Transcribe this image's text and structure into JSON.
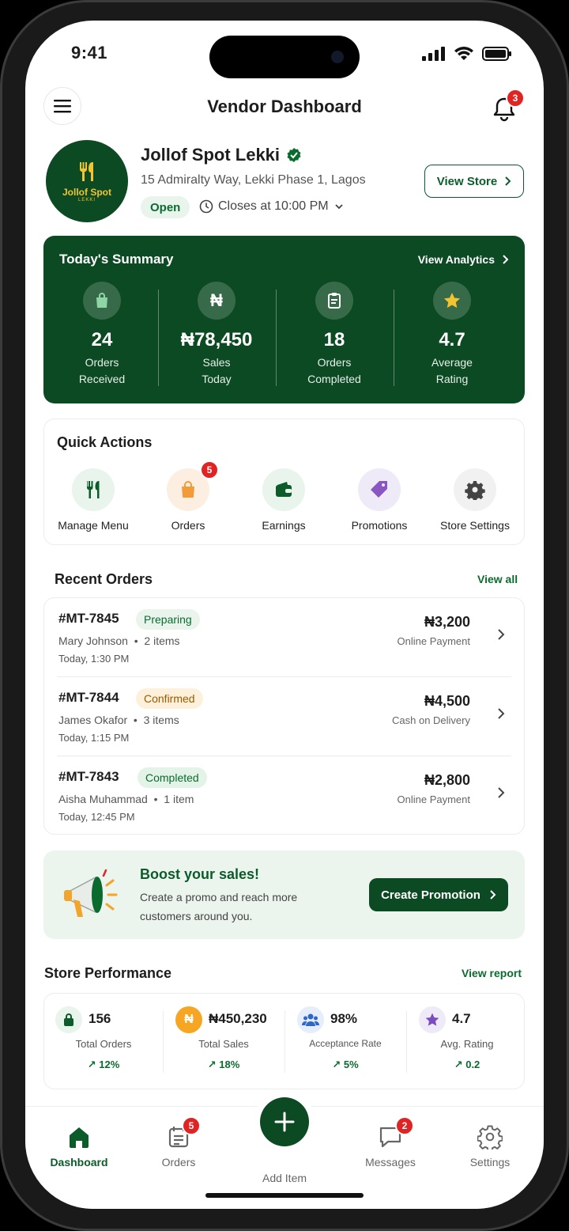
{
  "status_bar": {
    "time": "9:41"
  },
  "header": {
    "title": "Vendor Dashboard",
    "notification_count": "3"
  },
  "store": {
    "logo_name": "Jollof Spot",
    "logo_sub": "LEKKI",
    "name": "Jollof Spot Lekki",
    "address": "15 Admiralty Way, Lekki Phase 1, Lagos",
    "status": "Open",
    "closes": "Closes at 10:00 PM",
    "view_store_label": "View Store"
  },
  "summary": {
    "title": "Today's Summary",
    "link": "View Analytics",
    "stats": [
      {
        "value": "24",
        "label1": "Orders",
        "label2": "Received",
        "icon": "shopping-bag-icon"
      },
      {
        "value": "₦78,450",
        "label1": "Sales",
        "label2": "Today",
        "icon": "naira-icon"
      },
      {
        "value": "18",
        "label1": "Orders",
        "label2": "Completed",
        "icon": "clipboard-icon"
      },
      {
        "value": "4.7",
        "label1": "Average",
        "label2": "Rating",
        "icon": "star-icon"
      }
    ]
  },
  "quick_actions": {
    "title": "Quick Actions",
    "items": [
      {
        "label": "Manage Menu",
        "icon": "fork-knife-icon"
      },
      {
        "label": "Orders",
        "icon": "shopping-bag-icon",
        "badge": "5"
      },
      {
        "label": "Earnings",
        "icon": "wallet-icon"
      },
      {
        "label": "Promotions",
        "icon": "tag-icon"
      },
      {
        "label": "Store Settings",
        "icon": "gear-icon"
      }
    ]
  },
  "recent_orders": {
    "title": "Recent Orders",
    "view_all": "View all",
    "orders": [
      {
        "id": "#MT-7845",
        "status": "Preparing",
        "customer": "Mary Johnson",
        "items": "2 items",
        "time": "Today, 1:30 PM",
        "amount": "₦3,200",
        "payment": "Online Payment"
      },
      {
        "id": "#MT-7844",
        "status": "Confirmed",
        "customer": "James Okafor",
        "items": "3 items",
        "time": "Today, 1:15 PM",
        "amount": "₦4,500",
        "payment": "Cash on Delivery"
      },
      {
        "id": "#MT-7843",
        "status": "Completed",
        "customer": "Aisha Muhammad",
        "items": "1 item",
        "time": "Today, 12:45 PM",
        "amount": "₦2,800",
        "payment": "Online Payment"
      }
    ]
  },
  "promo": {
    "title": "Boost your sales!",
    "text": "Create a promo and reach more customers around you.",
    "button": "Create Promotion"
  },
  "performance": {
    "title": "Store Performance",
    "link": "View report",
    "metrics": [
      {
        "value": "156",
        "label": "Total Orders",
        "trend": "12%"
      },
      {
        "value": "₦450,230",
        "label": "Total Sales",
        "trend": "18%"
      },
      {
        "value": "98%",
        "label": "Acceptance Rate",
        "trend": "5%"
      },
      {
        "value": "4.7",
        "label": "Avg. Rating",
        "trend": "0.2"
      }
    ]
  },
  "bottom_nav": {
    "dashboard": "Dashboard",
    "orders": "Orders",
    "orders_badge": "5",
    "add_item": "Add Item",
    "messages": "Messages",
    "messages_badge": "2",
    "settings": "Settings"
  },
  "colors": {
    "brand": "#0b4a22",
    "accent": "#0b6b2e",
    "badge": "#e02424"
  }
}
